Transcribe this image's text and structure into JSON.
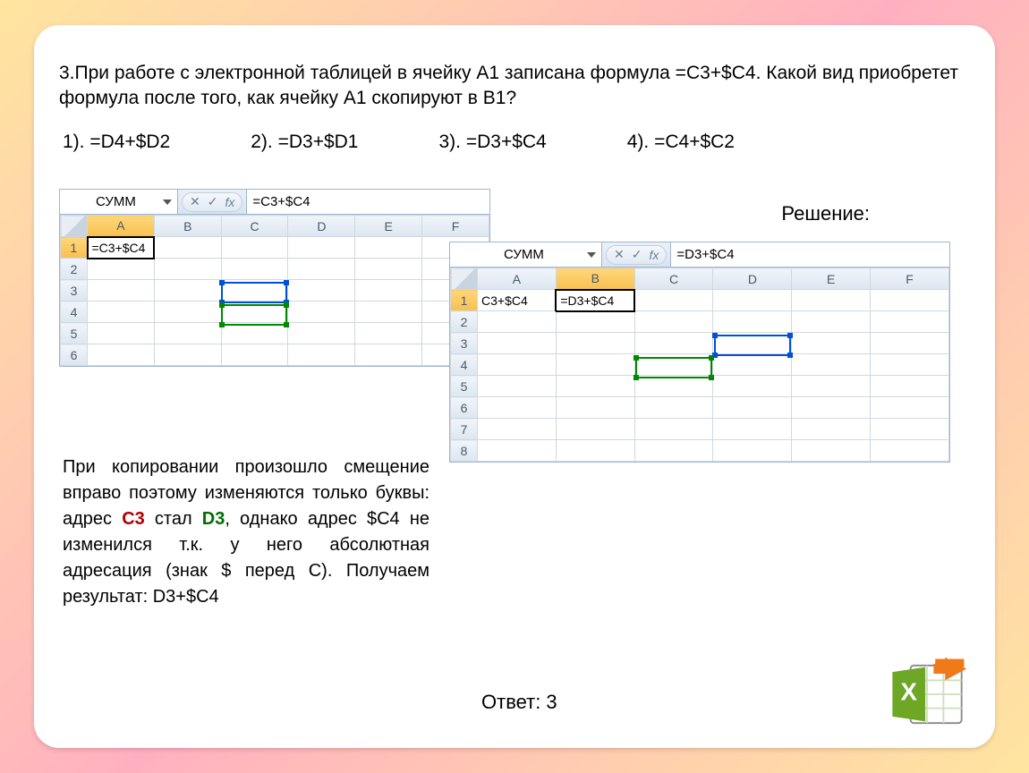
{
  "question": "3.При работе с электронной таблицей в ячейку А1 записана формула =С3+$С4. Какой вид приобретет формула после того, как  ячейку А1 скопируют в В1?",
  "options": {
    "o1": "1). =D4+$D2",
    "o2": "2). =D3+$D1",
    "o3": "3). =D3+$C4",
    "o4": "4). =C4+$C2"
  },
  "solution_label": "Решение:",
  "excel1": {
    "namebox": "СУММ",
    "fx": "=C3+$C4",
    "cols": [
      "A",
      "B",
      "C",
      "D",
      "E",
      "F"
    ],
    "a1": "=C3+$C4"
  },
  "excel2": {
    "namebox": "СУММ",
    "fx": "=D3+$C4",
    "cols": [
      "A",
      "B",
      "C",
      "D",
      "E",
      "F"
    ],
    "a1": "C3+$C4",
    "b1": "=D3+$C4"
  },
  "explain_parts": {
    "p1": "При копировании произошло смещение вправо поэтому изменяются только буквы: адрес ",
    "c3": "С3",
    "p2": " стал ",
    "d3": "D3",
    "p3": ", однако адрес $С4 не изменился т.к. у него абсолютная адресация (знак $ перед С). Получаем результат: D3+$С4"
  },
  "answer": "Ответ: 3",
  "fx_label": "fx"
}
